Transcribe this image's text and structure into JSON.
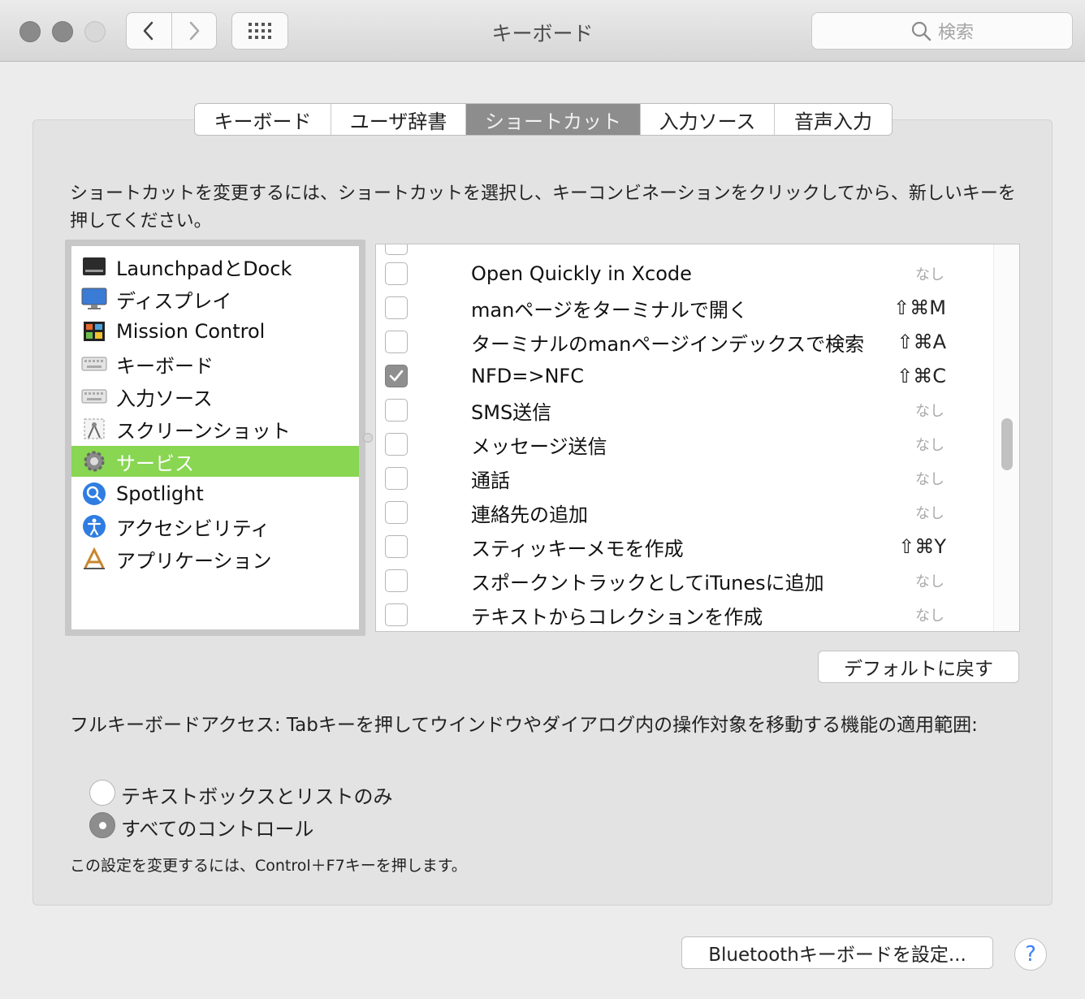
{
  "window": {
    "title": "キーボード",
    "search_placeholder": "検索"
  },
  "tabs": [
    {
      "label": "キーボード",
      "active": false
    },
    {
      "label": "ユーザ辞書",
      "active": false
    },
    {
      "label": "ショートカット",
      "active": true
    },
    {
      "label": "入力ソース",
      "active": false
    },
    {
      "label": "音声入力",
      "active": false
    }
  ],
  "instructions": "ショートカットを変更するには、ショートカットを選択し、キーコンビネーションをクリックしてから、新しいキーを押してください。",
  "categories": [
    {
      "label": "LaunchpadとDock",
      "icon": "launchpad-dock-icon",
      "selected": false
    },
    {
      "label": "ディスプレイ",
      "icon": "display-icon",
      "selected": false
    },
    {
      "label": "Mission Control",
      "icon": "mission-control-icon",
      "selected": false
    },
    {
      "label": "キーボード",
      "icon": "keyboard-icon",
      "selected": false
    },
    {
      "label": "入力ソース",
      "icon": "input-source-icon",
      "selected": false
    },
    {
      "label": "スクリーンショット",
      "icon": "screenshot-icon",
      "selected": false
    },
    {
      "label": "サービス",
      "icon": "services-gear-icon",
      "selected": true
    },
    {
      "label": "Spotlight",
      "icon": "spotlight-icon",
      "selected": false
    },
    {
      "label": "アクセシビリティ",
      "icon": "accessibility-icon",
      "selected": false
    },
    {
      "label": "アプリケーション",
      "icon": "applications-icon",
      "selected": false
    }
  ],
  "shortcuts": [
    {
      "label": "Open Quickly in Xcode",
      "key": "なし",
      "checked": false
    },
    {
      "label": "manページをターミナルで開く",
      "key": "⇧⌘M",
      "checked": false
    },
    {
      "label": "ターミナルのmanページインデックスで検索",
      "key": "⇧⌘A",
      "checked": false
    },
    {
      "label": "NFD=>NFC",
      "key": "⇧⌘C",
      "checked": true
    },
    {
      "label": "SMS送信",
      "key": "なし",
      "checked": false
    },
    {
      "label": "メッセージ送信",
      "key": "なし",
      "checked": false
    },
    {
      "label": "通話",
      "key": "なし",
      "checked": false
    },
    {
      "label": "連絡先の追加",
      "key": "なし",
      "checked": false
    },
    {
      "label": "スティッキーメモを作成",
      "key": "⇧⌘Y",
      "checked": false
    },
    {
      "label": "スポークントラックとしてiTunesに追加",
      "key": "なし",
      "checked": false
    },
    {
      "label": "テキストからコレクションを作成",
      "key": "なし",
      "checked": false
    }
  ],
  "restore_defaults": "デフォルトに戻す",
  "full_keyboard_access": {
    "label": "フルキーボードアクセス: Tabキーを押してウインドウやダイアログ内の操作対象を移動する機能の適用範囲:",
    "options": [
      {
        "label": "テキストボックスとリストのみ",
        "selected": false
      },
      {
        "label": "すべてのコントロール",
        "selected": true
      }
    ],
    "note": "この設定を変更するには、Control＋F7キーを押します。"
  },
  "bluetooth_button": "Bluetoothキーボードを設定...",
  "help_label": "?"
}
